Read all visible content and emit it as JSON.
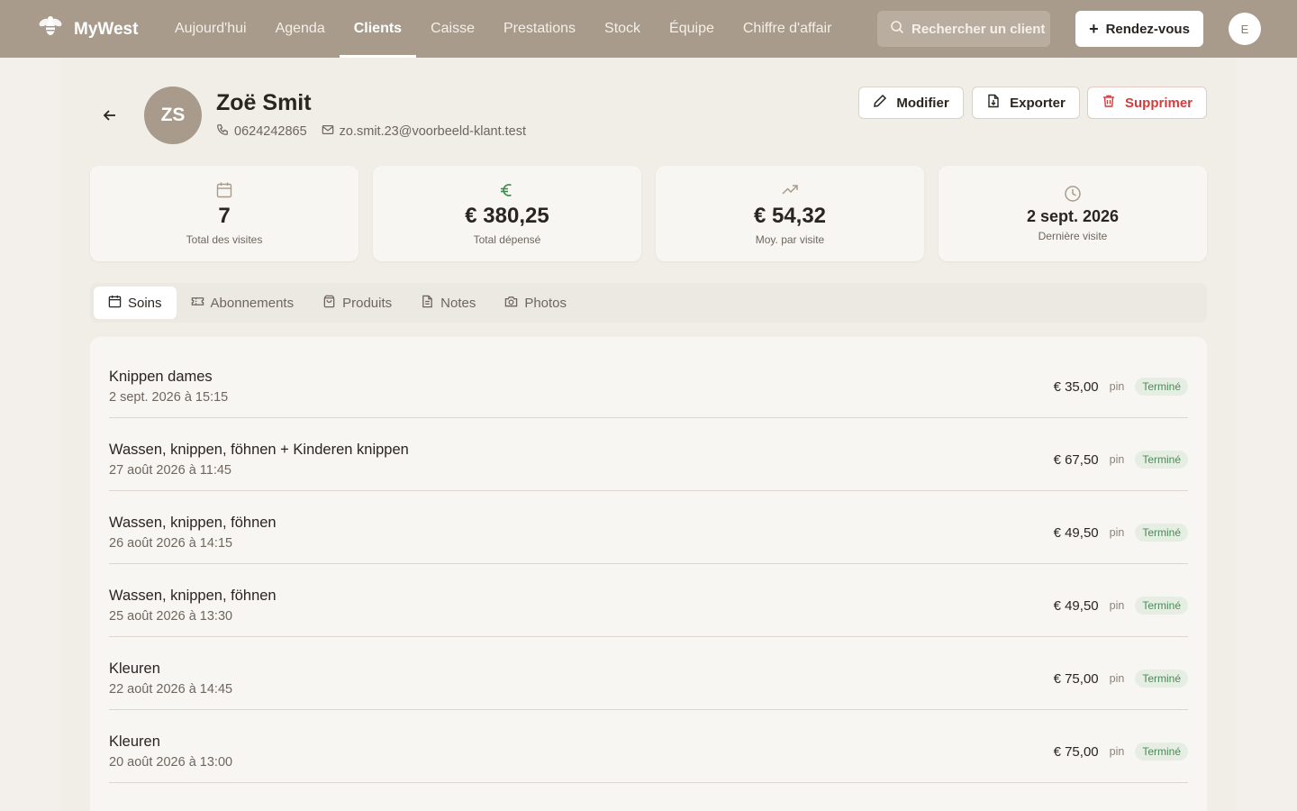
{
  "app": {
    "name": "MyWest",
    "user_initial": "E"
  },
  "nav": [
    "Aujourd'hui",
    "Agenda",
    "Clients",
    "Caisse",
    "Prestations",
    "Stock",
    "Équipe",
    "Chiffre d'affair"
  ],
  "nav_active": "Clients",
  "search": {
    "label": "Rechercher un client"
  },
  "new_appointment_label": "Rendez-vous",
  "client": {
    "initials": "ZS",
    "name": "Zoë Smit",
    "phone": "0624242865",
    "email": "zo.smit.23@voorbeeld-klant.test"
  },
  "actions": {
    "edit": "Modifier",
    "export": "Exporter",
    "delete": "Supprimer"
  },
  "stats": [
    {
      "value": "7",
      "label": "Total des visites",
      "icon": "calendar-icon"
    },
    {
      "value": "€ 380,25",
      "label": "Total dépensé",
      "icon": "euro-icon"
    },
    {
      "value": "€ 54,32",
      "label": "Moy. par visite",
      "icon": "trending-up-icon"
    },
    {
      "value": "2 sept. 2026",
      "label": "Dernière visite",
      "icon": "clock-icon"
    }
  ],
  "tabs": [
    "Soins",
    "Abonnements",
    "Produits",
    "Notes",
    "Photos"
  ],
  "active_tab": "Soins",
  "treatments": [
    {
      "title": "Knippen dames",
      "date": "2 sept. 2026 à 15:15",
      "price": "€ 35,00",
      "payment": "pin",
      "status": "Terminé"
    },
    {
      "title": "Wassen, knippen, föhnen + Kinderen knippen",
      "date": "27 août 2026 à 11:45",
      "price": "€ 67,50",
      "payment": "pin",
      "status": "Terminé"
    },
    {
      "title": "Wassen, knippen, föhnen",
      "date": "26 août 2026 à 14:15",
      "price": "€ 49,50",
      "payment": "pin",
      "status": "Terminé"
    },
    {
      "title": "Wassen, knippen, föhnen",
      "date": "25 août 2026 à 13:30",
      "price": "€ 49,50",
      "payment": "pin",
      "status": "Terminé"
    },
    {
      "title": "Kleuren",
      "date": "22 août 2026 à 14:45",
      "price": "€ 75,00",
      "payment": "pin",
      "status": "Terminé"
    },
    {
      "title": "Kleuren",
      "date": "20 août 2026 à 13:00",
      "price": "€ 75,00",
      "payment": "pin",
      "status": "Terminé"
    }
  ]
}
